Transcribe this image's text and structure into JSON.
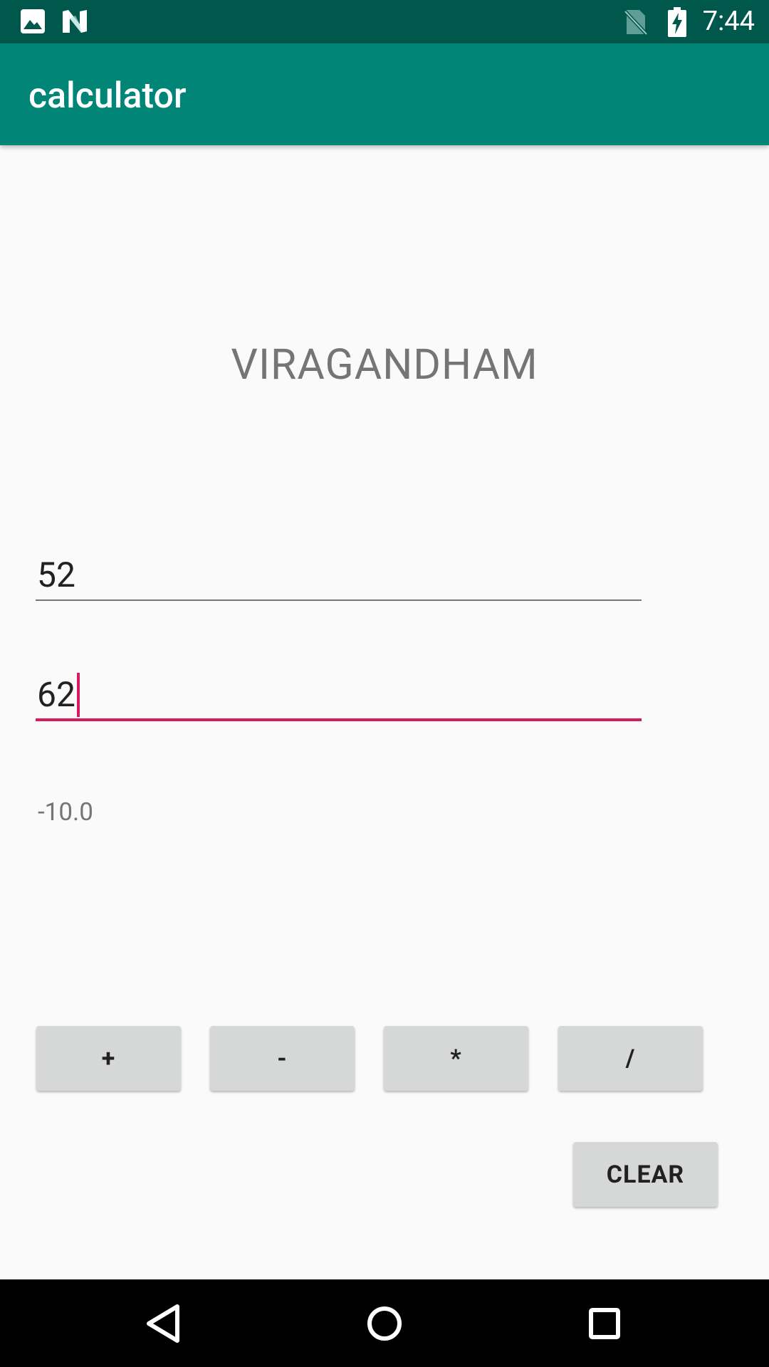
{
  "status_bar": {
    "time": "7:44",
    "icons": [
      "image-icon",
      "n-logo-icon",
      "no-sim-icon",
      "battery-charging-icon"
    ],
    "background_color": "#00574b"
  },
  "app_bar": {
    "title": "calculator",
    "background_color": "#008577"
  },
  "main": {
    "heading": "VIRAGANDHAM",
    "first_number": "52",
    "second_number": "62",
    "result": "-10.0",
    "accent_color": "#d81b60"
  },
  "buttons": {
    "add": "+",
    "subtract": "-",
    "multiply": "*",
    "divide": "/",
    "clear": "CLEAR"
  },
  "nav_bar": {
    "icons": [
      "back-icon",
      "home-icon",
      "recents-icon"
    ]
  }
}
